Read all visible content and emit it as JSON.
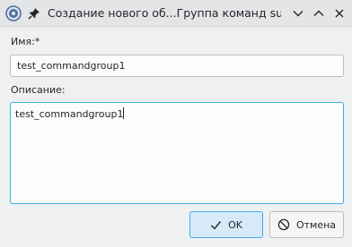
{
  "window": {
    "title": "Создание нового об...Группа команд sudo",
    "icons": {
      "app": "freeipa-logo-icon",
      "pin": "pin-icon",
      "minimize": "chevron-down-icon",
      "maximize": "chevron-up-icon",
      "close": "close-icon"
    }
  },
  "form": {
    "name_label": "Имя:*",
    "name_value": "test_commandgroup1",
    "description_label": "Описание:",
    "description_value": "test_commandgroup1"
  },
  "buttons": {
    "ok_label": "OK",
    "ok_icon": "checkmark-icon",
    "cancel_label": "Отмена",
    "cancel_icon": "cancel-icon"
  },
  "colors": {
    "accent": "#3daee9",
    "window_bg": "#eff0f1",
    "titlebar_bg": "#e3e5e7"
  }
}
